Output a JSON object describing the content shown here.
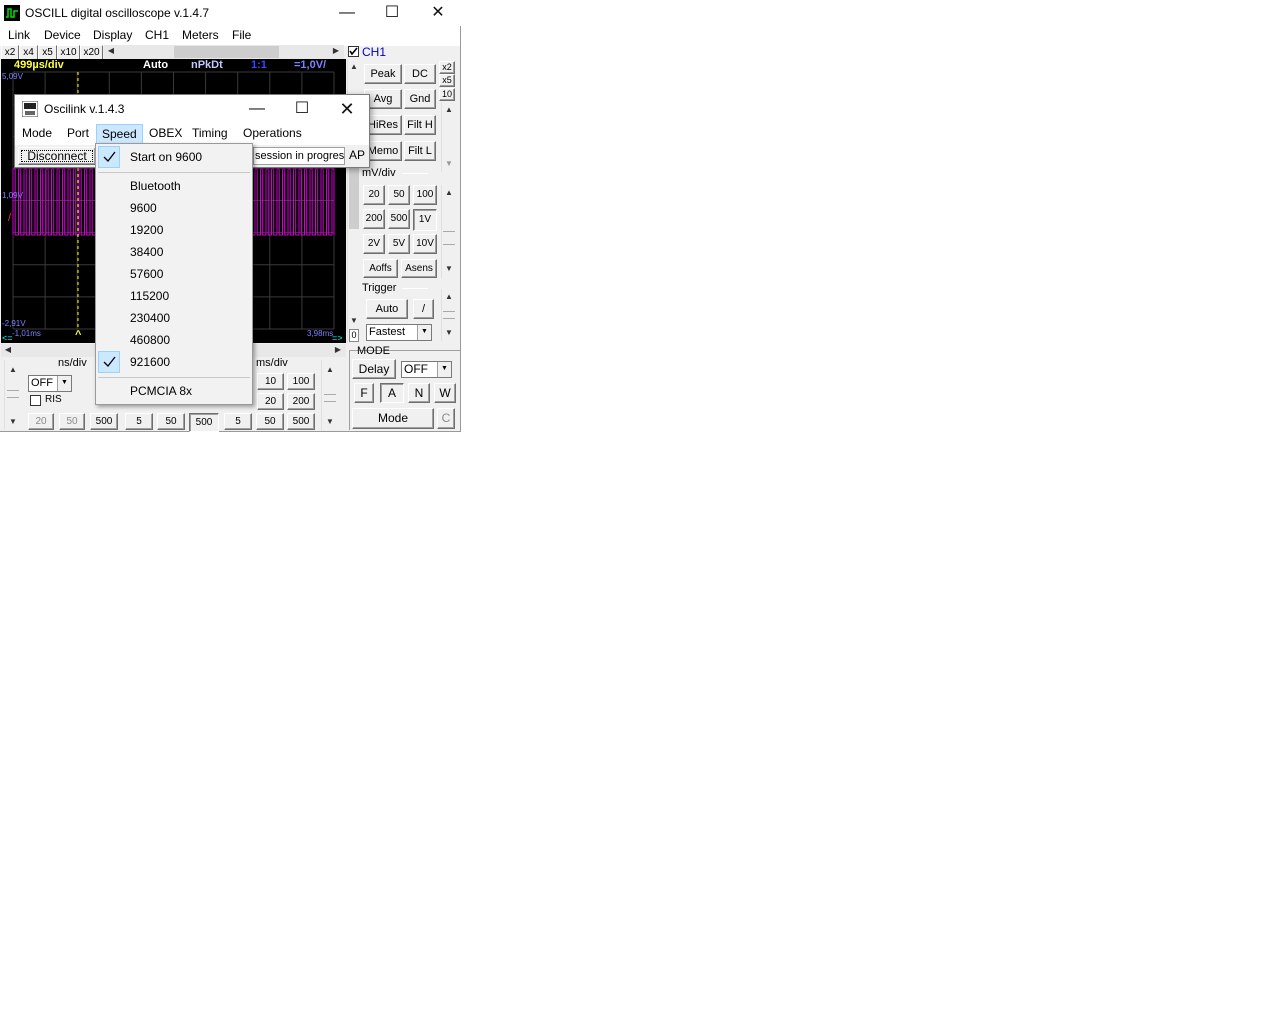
{
  "main_window": {
    "title": "OSCILL digital oscilloscope  v.1.4.7",
    "menu": [
      "Link",
      "Device",
      "Display",
      "CH1",
      "Meters",
      "File"
    ],
    "zoom_buttons": [
      "x2",
      "x4",
      "x5",
      "x10",
      "x20"
    ],
    "scope": {
      "timebase": "499µs/div",
      "trigger_mode": "Auto",
      "mode_label": "nPkDt",
      "ratio": "1:1",
      "volts_div": "=1,0V/",
      "y_top": "5,09V",
      "y_mid": "1,09V",
      "y_bottom": "-2,91V",
      "x_left": "-1,01ms",
      "x_right": "3,98ms",
      "cursor_left": "<=",
      "cursor_right": "=>",
      "trigger_marker": "^",
      "level_marker": "/",
      "v_scroll_value": "0"
    },
    "ch1": {
      "label": "CH1",
      "buttons_row1": [
        "Peak",
        "DC"
      ],
      "buttons_row2": [
        "Avg",
        "Gnd"
      ],
      "buttons_row3": [
        "HiRes",
        "Filt H"
      ],
      "buttons_row4": [
        "Memo",
        "Filt L"
      ],
      "side_buttons": [
        "x2",
        "x5",
        "10"
      ],
      "mv_div_label": "mV/div",
      "mv_row1": [
        "20",
        "50",
        "100"
      ],
      "mv_row2": [
        "200",
        "500",
        "1V"
      ],
      "mv_row3": [
        "2V",
        "5V",
        "10V"
      ],
      "mv_row4": [
        "Aoffs",
        "Asens"
      ],
      "trigger_label": "Trigger",
      "trigger_auto": "Auto",
      "trigger_slope": "/",
      "trigger_speed": "Fastest"
    },
    "mode_panel": {
      "label": "MODE",
      "delay_button": "Delay",
      "delay_value": "OFF",
      "buttons": [
        "F",
        "A",
        "N",
        "W"
      ],
      "mode_button": "Mode",
      "c_button": "C"
    },
    "timebase_panel": {
      "ns_div_label": "ns/div",
      "ns_combo": "OFF",
      "ris_label": "RIS",
      "ns_buttons": [
        "20",
        "50",
        "500"
      ],
      "us_buttons": [
        "5",
        "50",
        "500"
      ],
      "ms_div_label": "ms/div",
      "ms_row1": [
        "10",
        "100"
      ],
      "ms_row2": [
        "20",
        "200"
      ],
      "ms_row3": [
        "5",
        "50",
        "500"
      ]
    }
  },
  "oscilink_window": {
    "title": "Oscilink  v.1.4.3",
    "menu": [
      "Mode",
      "Port",
      "Speed",
      "OBEX",
      "Timing",
      "Operations"
    ],
    "disconnect_button": "Disconnect",
    "status_text": "session in progress",
    "ap_label": "AP"
  },
  "speed_menu": {
    "items": [
      {
        "label": "Start on 9600",
        "checked": true
      },
      {
        "label": "Bluetooth",
        "checked": false
      },
      {
        "label": "9600",
        "checked": false
      },
      {
        "label": "19200",
        "checked": false
      },
      {
        "label": "38400",
        "checked": false
      },
      {
        "label": "57600",
        "checked": false
      },
      {
        "label": "115200",
        "checked": false
      },
      {
        "label": "230400",
        "checked": false
      },
      {
        "label": "460800",
        "checked": false
      },
      {
        "label": "921600",
        "checked": true
      },
      {
        "label": "PCMCIA 8x",
        "checked": false
      }
    ]
  },
  "colors": {
    "scope_bg": "#000000",
    "trace": "#d400d4",
    "grid": "#3a3a3a",
    "timebase_text": "#ffff40",
    "cursor": "#ffff00",
    "check_highlight": "#cce8ff"
  }
}
